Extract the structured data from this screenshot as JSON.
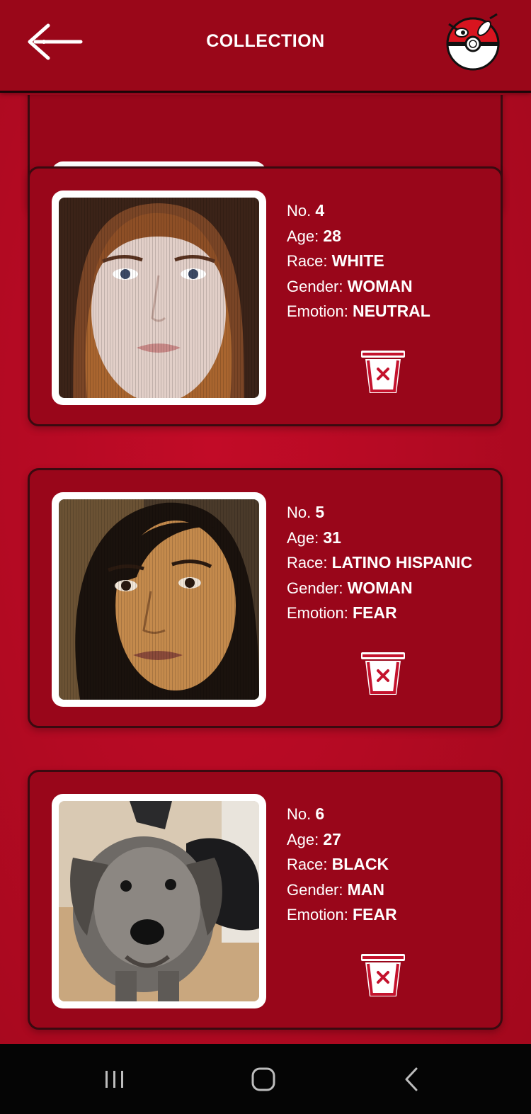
{
  "header": {
    "title": "COLLECTION",
    "back_icon": "back-arrow-icon",
    "logo_icon": "pokeball-logo-icon"
  },
  "labels": {
    "number": "No.",
    "age": "Age:",
    "race": "Race:",
    "gender": "Gender:",
    "emotion": "Emotion:"
  },
  "cards": [
    {
      "number": "4",
      "age": "28",
      "race": "WHITE",
      "gender": "WOMAN",
      "emotion": "NEUTRAL",
      "photo": "woman-portrait"
    },
    {
      "number": "5",
      "age": "31",
      "race": "LATINO HISPANIC",
      "gender": "WOMAN",
      "emotion": "FEAR",
      "photo": "woman-portrait"
    },
    {
      "number": "6",
      "age": "27",
      "race": "BLACK",
      "gender": "MAN",
      "emotion": "FEAR",
      "photo": "dog-photo"
    }
  ],
  "colors": {
    "background": "#b40a23",
    "card": "#99061a",
    "header": "#9a0719",
    "accent": "#ffffff",
    "trash": "#c4122d"
  },
  "navbar": {
    "icons": [
      "recent-apps-icon",
      "home-icon",
      "back-icon"
    ]
  }
}
